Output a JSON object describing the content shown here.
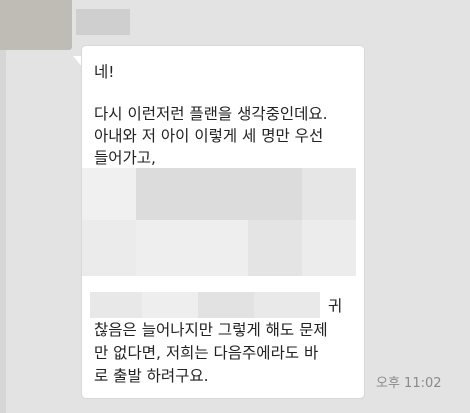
{
  "message": {
    "lines": [
      "네!",
      "다시 이런저런 플랜을 생각중인데요.",
      "아내와 저 아이 이렇게 세 명만 우선",
      "들어가고,",
      "귀",
      "찮음은 늘어나지만 그렇게 해도 문제",
      "만 없다면, 저희는 다음주에라도 바",
      "로 출발 하려구요."
    ],
    "time": "오후 11:02"
  },
  "colors": {
    "background": "#e3e3e3",
    "bubble": "#ffffff",
    "text": "#222222",
    "time": "#8a8a8a"
  }
}
